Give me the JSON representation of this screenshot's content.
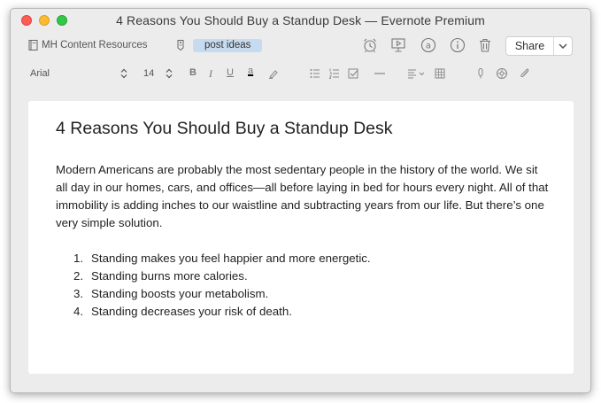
{
  "window": {
    "title": "4 Reasons You Should Buy a Standup Desk — Evernote Premium"
  },
  "toolbar": {
    "notebook": "MH Content Resources",
    "tag": "post ideas",
    "share_label": "Share",
    "icons": [
      "notebook-icon",
      "tag-icon",
      "reminder-icon",
      "presentation-icon",
      "at-icon",
      "info-icon",
      "trash-icon",
      "chevron-down-icon"
    ]
  },
  "format_bar": {
    "font": "Arial",
    "size": "14",
    "bold": "B",
    "italic": "I",
    "underline": "U",
    "text_color": "a"
  },
  "note": {
    "title": "4 Reasons You Should Buy a Standup Desk",
    "paragraph": "Modern Americans are probably the most sedentary people in the history of the world. We sit all day in our homes, cars, and offices—all before laying in bed for hours every night. All of that immobility is adding inches to our waistline and subtracting years from our life. But there’s one very simple solution.",
    "list": [
      {
        "num": "1.",
        "text": "Standing makes you feel happier and more energetic."
      },
      {
        "num": "2.",
        "text": "Standing burns more calories."
      },
      {
        "num": "3.",
        "text": "Standing boosts your metabolism."
      },
      {
        "num": "4.",
        "text": "Standing decreases your risk of death."
      }
    ]
  },
  "colors": {
    "tag_bg": "#c7dbf0",
    "close": "#fc5b57",
    "minimize": "#fdbb2f",
    "maximize": "#33c748"
  }
}
